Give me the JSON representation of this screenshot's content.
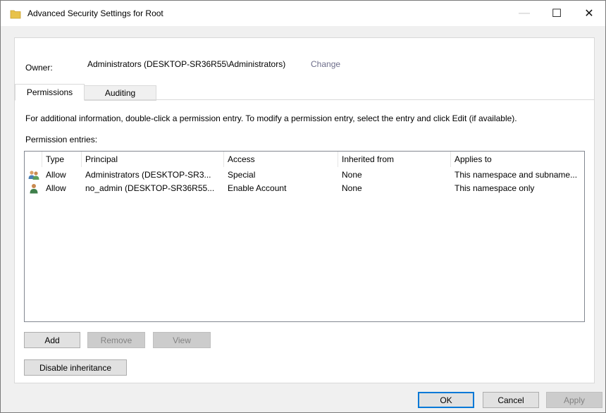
{
  "window": {
    "title": "Advanced Security Settings for Root",
    "min_glyph": "—",
    "max_glyph": "☐",
    "close_glyph": "✕"
  },
  "owner": {
    "label": "Owner:",
    "value": "Administrators (DESKTOP-SR36R55\\Administrators)",
    "change_link": "Change"
  },
  "tabs": [
    {
      "label": "Permissions",
      "selected": true
    },
    {
      "label": "Auditing",
      "selected": false
    }
  ],
  "info_text": "For additional information, double-click a permission entry. To modify a permission entry, select the entry and click Edit (if available).",
  "entries_label": "Permission entries:",
  "table": {
    "columns": [
      "Type",
      "Principal",
      "Access",
      "Inherited from",
      "Applies to"
    ],
    "rows": [
      {
        "icon": "group-users-icon",
        "type": "Allow",
        "principal": "Administrators (DESKTOP-SR3...",
        "access": "Special",
        "inherited": "None",
        "applies": "This namespace and subname..."
      },
      {
        "icon": "user-icon",
        "type": "Allow",
        "principal": "no_admin (DESKTOP-SR36R55...",
        "access": "Enable Account",
        "inherited": "None",
        "applies": "This namespace only"
      }
    ]
  },
  "buttons": {
    "add": "Add",
    "remove": "Remove",
    "view": "View",
    "disable_inheritance": "Disable inheritance",
    "ok": "OK",
    "cancel": "Cancel",
    "apply": "Apply"
  },
  "colors": {
    "accent": "#0078d7",
    "folder": "#e8c24a",
    "link": "#6d6d8a"
  }
}
